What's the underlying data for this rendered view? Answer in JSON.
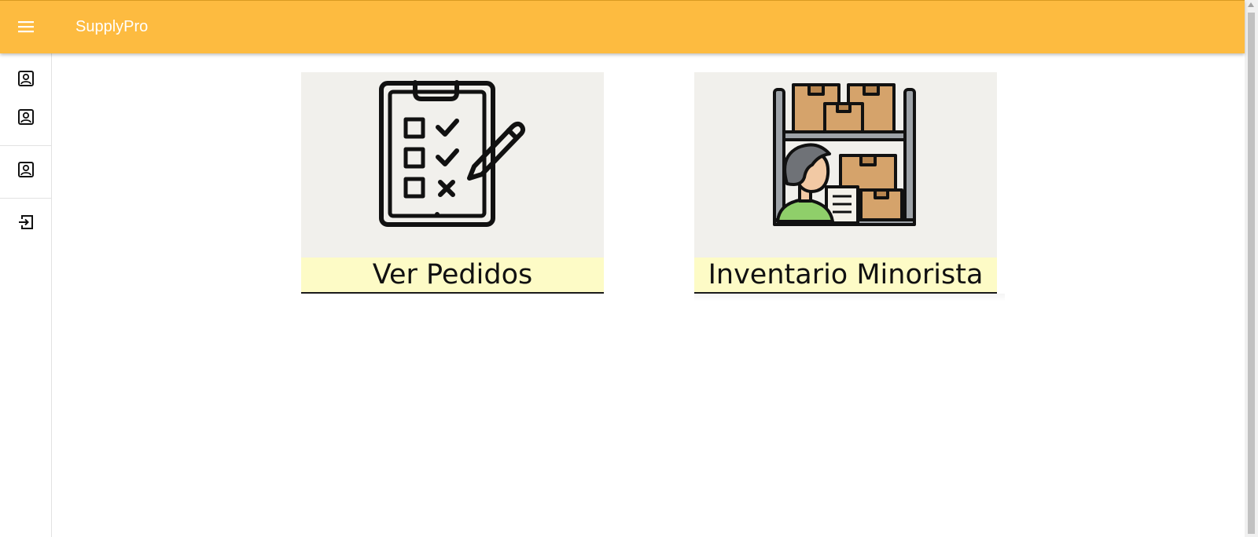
{
  "app_bar": {
    "title": "SupplyPro",
    "color": "#fdbb40",
    "menu_icon": "menu-icon"
  },
  "sidebar": {
    "items": [
      {
        "name": "account-box-icon",
        "group": 1
      },
      {
        "name": "account-box-icon",
        "group": 1
      },
      {
        "name": "account-box-icon",
        "group": 2
      },
      {
        "name": "logout-icon",
        "group": 3
      }
    ]
  },
  "cards": [
    {
      "label": "Ver Pedidos",
      "icon": "clipboard-checklist-icon"
    },
    {
      "label": "Inventario Minorista",
      "icon": "warehouse-worker-icon"
    }
  ],
  "colors": {
    "card_image_bg": "#f1f0ec",
    "card_label_bg": "#fdfbc6"
  }
}
